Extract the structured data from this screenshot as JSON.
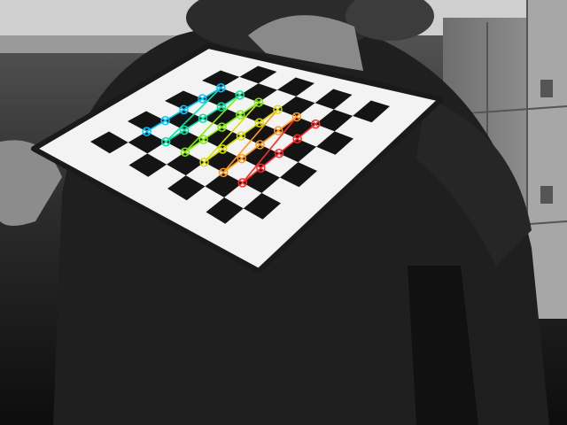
{
  "image": {
    "subject": "chessboard-calibration-detection",
    "colors": {
      "background": "#2a2a2a",
      "board_paper": "#f3f3f3",
      "board_square": "#141414",
      "row_colors": [
        "#00c8ff",
        "#00e5a8",
        "#7ef000",
        "#d8e000",
        "#ff9a1a",
        "#ff2a2a"
      ]
    },
    "corner_grid": {
      "rows": 6,
      "cols": 5
    }
  }
}
